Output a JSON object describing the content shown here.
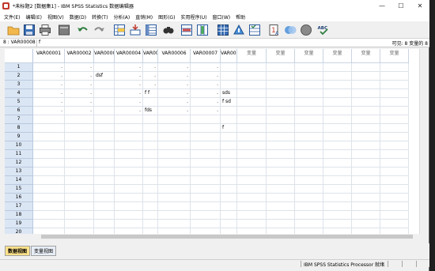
{
  "window": {
    "title": "*未标题2 [数据集1] - IBM SPSS Statistics 数据编辑器",
    "minimize_glyph": "—",
    "maximize_glyph": "☐",
    "close_glyph": "✕"
  },
  "menu": [
    "文件(E)",
    "编辑(E)",
    "视图(V)",
    "数据(D)",
    "转换(T)",
    "分析(A)",
    "直销(M)",
    "图形(G)",
    "实用程序(U)",
    "窗口(W)",
    "帮助"
  ],
  "toolbar": {
    "icons": [
      "open-folder-icon",
      "save-icon",
      "print-icon",
      "dialog-recall-icon",
      "undo-icon",
      "redo-icon",
      "goto-case-icon",
      "goto-variable-icon",
      "variables-icon",
      "find-icon",
      "insert-cases-icon",
      "insert-variable-icon",
      "split-file-icon",
      "weight-cases-icon",
      "select-cases-icon",
      "value-labels-icon",
      "use-sets-icon",
      "show-all-variables-icon",
      "spell-check-icon"
    ],
    "spell_label": "ABC"
  },
  "cell_editor": {
    "reference": "8 : VAR00008",
    "value": "f",
    "visible_count": "可见: 8 变量的 8"
  },
  "columns": [
    "VAR00001",
    "VAR00002",
    "VAR00003",
    "VAR00004",
    "VAR00005",
    "VAR00006",
    "VAR00007",
    "VAR00008",
    "变量",
    "变量",
    "变量",
    "变量",
    "变量",
    "变量"
  ],
  "rows": [
    {
      "n": "1",
      "cells": [
        ".",
        ".",
        "",
        ".",
        ".",
        ".",
        ".",
        ""
      ]
    },
    {
      "n": "2",
      "cells": [
        ".",
        ".",
        "dsf",
        ".",
        ".",
        ".",
        ".",
        ""
      ]
    },
    {
      "n": "3",
      "cells": [
        ".",
        ".",
        "",
        ".",
        ".",
        ".",
        ".",
        ""
      ]
    },
    {
      "n": "4",
      "cells": [
        ".",
        ".",
        "",
        ".",
        "f f",
        ".",
        ".",
        "sds"
      ]
    },
    {
      "n": "5",
      "cells": [
        ".",
        ".",
        "",
        ".",
        "",
        ".",
        ".",
        "f sd"
      ]
    },
    {
      "n": "6",
      "cells": [
        ".",
        ".",
        "",
        ".",
        "fds",
        ".",
        ".",
        ""
      ]
    },
    {
      "n": "7",
      "cells": [
        "",
        "",
        "",
        "",
        "",
        "",
        "",
        ""
      ]
    },
    {
      "n": "8",
      "cells": [
        "",
        "",
        "",
        "",
        "",
        "",
        "",
        "f"
      ]
    },
    {
      "n": "9",
      "cells": [
        "",
        "",
        "",
        "",
        "",
        "",
        "",
        ""
      ]
    },
    {
      "n": "10",
      "cells": [
        "",
        "",
        "",
        "",
        "",
        "",
        "",
        ""
      ]
    },
    {
      "n": "11",
      "cells": [
        "",
        "",
        "",
        "",
        "",
        "",
        "",
        ""
      ]
    },
    {
      "n": "12",
      "cells": [
        "",
        "",
        "",
        "",
        "",
        "",
        "",
        ""
      ]
    },
    {
      "n": "13",
      "cells": [
        "",
        "",
        "",
        "",
        "",
        "",
        "",
        ""
      ]
    },
    {
      "n": "14",
      "cells": [
        "",
        "",
        "",
        "",
        "",
        "",
        "",
        ""
      ]
    },
    {
      "n": "15",
      "cells": [
        "",
        "",
        "",
        "",
        "",
        "",
        "",
        ""
      ]
    },
    {
      "n": "16",
      "cells": [
        "",
        "",
        "",
        "",
        "",
        "",
        "",
        ""
      ]
    },
    {
      "n": "17",
      "cells": [
        "",
        "",
        "",
        "",
        "",
        "",
        "",
        ""
      ]
    },
    {
      "n": "18",
      "cells": [
        "",
        "",
        "",
        "",
        "",
        "",
        "",
        ""
      ]
    },
    {
      "n": "19",
      "cells": [
        "",
        "",
        "",
        "",
        "",
        "",
        "",
        ""
      ]
    },
    {
      "n": "20",
      "cells": [
        "",
        "",
        "",
        "",
        "",
        "",
        "",
        ""
      ]
    }
  ],
  "tabs": {
    "data_view": "数据视图",
    "variable_view": "变量视图"
  },
  "status": {
    "processor": "IBM SPSS Statistics Processor 就绪"
  },
  "colors": {
    "row_header": "#dbe6f4",
    "active_tab": "#ffe28a"
  }
}
